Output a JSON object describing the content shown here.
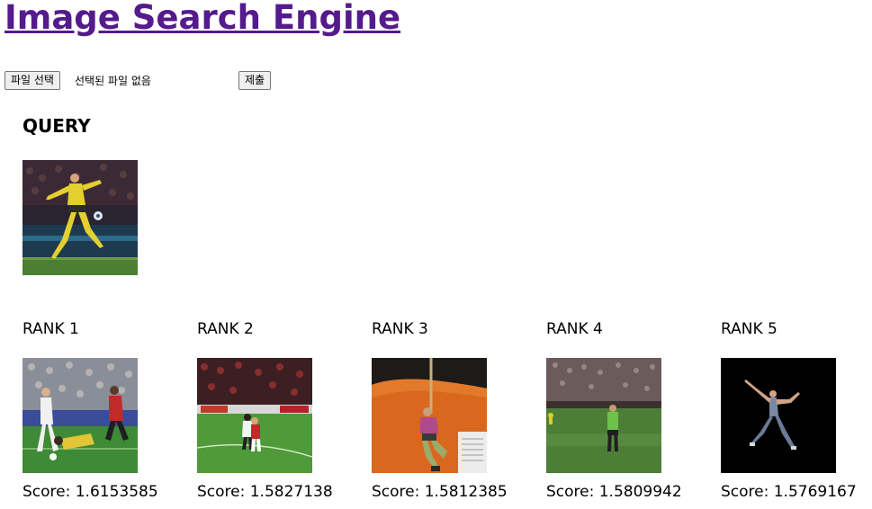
{
  "page": {
    "title": "Image Search Engine"
  },
  "upload_form": {
    "file_button_label": "파일 선택",
    "file_status": "선택된 파일 없음",
    "submit_label": "제출"
  },
  "query": {
    "heading": "QUERY",
    "image": "soccer player in yellow kit kicking ball"
  },
  "results": [
    {
      "rank": "RANK 1",
      "score": "Score: 1.6153585",
      "image": "soccer players tackling on pitch"
    },
    {
      "rank": "RANK 2",
      "score": "Score: 1.5827138",
      "image": "soccer players on field in stadium"
    },
    {
      "rank": "RANK 3",
      "score": "Score: 1.5812385",
      "image": "person climbing rope against orange wall"
    },
    {
      "rank": "RANK 4",
      "score": "Score: 1.5809942",
      "image": "soccer referee on pitch"
    },
    {
      "rank": "RANK 5",
      "score": "Score: 1.5769167",
      "image": "dancer leaping on black background"
    }
  ],
  "colors": {
    "link": "#551a8b",
    "button_bg": "#efefef",
    "button_border": "#767676"
  }
}
